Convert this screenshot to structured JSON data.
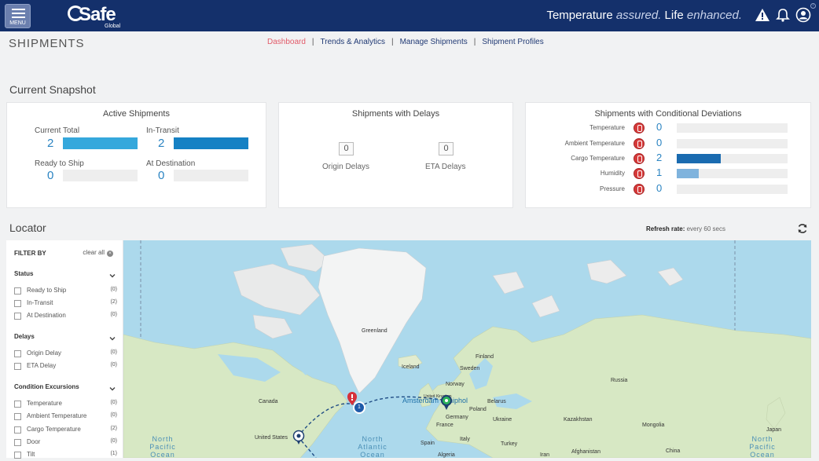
{
  "header": {
    "menu_label": "MENU",
    "logo_text": "Safe",
    "logo_sub": "Global",
    "tagline_part1": "Temperature ",
    "tagline_part2": "assured.",
    "tagline_part3": " Life ",
    "tagline_part4": "enhanced.",
    "icons": [
      "alert-icon",
      "bell-icon",
      "user-icon"
    ],
    "colors": {
      "bar": "#14306b",
      "accent": "#e25b69",
      "link": "#213a74",
      "value": "#2b84c2"
    }
  },
  "page": {
    "title": "SHIPMENTS",
    "nav": [
      {
        "label": "Dashboard",
        "active": true
      },
      {
        "label": "Trends & Analytics",
        "active": false
      },
      {
        "label": "Manage Shipments",
        "active": false
      },
      {
        "label": "Shipment Profiles",
        "active": false
      }
    ]
  },
  "snapshot": {
    "title": "Current Snapshot",
    "active": {
      "title": "Active Shipments",
      "metrics": [
        {
          "label": "Current Total",
          "value": "2",
          "fill": 1.0
        },
        {
          "label": "In-Transit",
          "value": "2",
          "fill": 1.0
        },
        {
          "label": "Ready to Ship",
          "value": "0",
          "fill": 0.0
        },
        {
          "label": "At Destination",
          "value": "0",
          "fill": 0.0
        }
      ]
    },
    "delays": {
      "title": "Shipments with Delays",
      "items": [
        {
          "label": "Origin Delays",
          "value": "0"
        },
        {
          "label": "ETA Delays",
          "value": "0"
        }
      ]
    },
    "deviations": {
      "title": "Shipments with Conditional Deviations",
      "rows": [
        {
          "label": "Temperature",
          "value": "0",
          "fill": 0.0
        },
        {
          "label": "Ambient Temperature",
          "value": "0",
          "fill": 0.0
        },
        {
          "label": "Cargo Temperature",
          "value": "2",
          "fill": 0.4
        },
        {
          "label": "Humidity",
          "value": "1",
          "fill": 0.2
        },
        {
          "label": "Pressure",
          "value": "0",
          "fill": 0.0
        }
      ]
    }
  },
  "locator": {
    "title": "Locator",
    "refresh_label": "Refresh rate:",
    "refresh_value": "every 60 secs",
    "filter": {
      "heading": "FILTER BY",
      "clear_all": "clear all",
      "groups": [
        {
          "title": "Status",
          "items": [
            {
              "label": "Ready to Ship",
              "count": "(0)"
            },
            {
              "label": "In-Transit",
              "count": "(2)"
            },
            {
              "label": "At Destination",
              "count": "(0)"
            }
          ]
        },
        {
          "title": "Delays",
          "items": [
            {
              "label": "Origin Delay",
              "count": "(0)"
            },
            {
              "label": "ETA Delay",
              "count": "(0)"
            }
          ]
        },
        {
          "title": "Condition Excursions",
          "items": [
            {
              "label": "Temperature",
              "count": "(0)"
            },
            {
              "label": "Ambient Temperature",
              "count": "(0)"
            },
            {
              "label": "Cargo Temperature",
              "count": "(2)"
            },
            {
              "label": "Door",
              "count": "(0)"
            },
            {
              "label": "Tilt",
              "count": "(1)"
            }
          ]
        }
      ]
    },
    "map": {
      "labels": {
        "greenland": "Greenland",
        "iceland": "Iceland",
        "canada": "Canada",
        "united_states": "United States",
        "sweden": "Sweden",
        "finland": "Finland",
        "norway": "Norway",
        "germany": "Germany",
        "france": "France",
        "poland": "Poland",
        "ukraine": "Ukraine",
        "belarus": "Belarus",
        "spain": "Spain",
        "italy": "Italy",
        "united_kingdom": "United Kingdom",
        "kazakhstan": "Kazakhstan",
        "mongolia": "Mongolia",
        "russia": "Russia",
        "china": "China",
        "algeria": "Algeria",
        "turkey": "Turkey",
        "iran": "Iran",
        "afghanistan": "Afghanistan",
        "japan": "Japan",
        "ocean_np1": "North\nPacific\nOcean",
        "ocean_na": "North\nAtlantic\nOcean",
        "ocean_np2": "North\nPacific\nOcean",
        "snapshot_marker": "Amsterdam Schiphol"
      },
      "cluster_count": "1"
    }
  }
}
